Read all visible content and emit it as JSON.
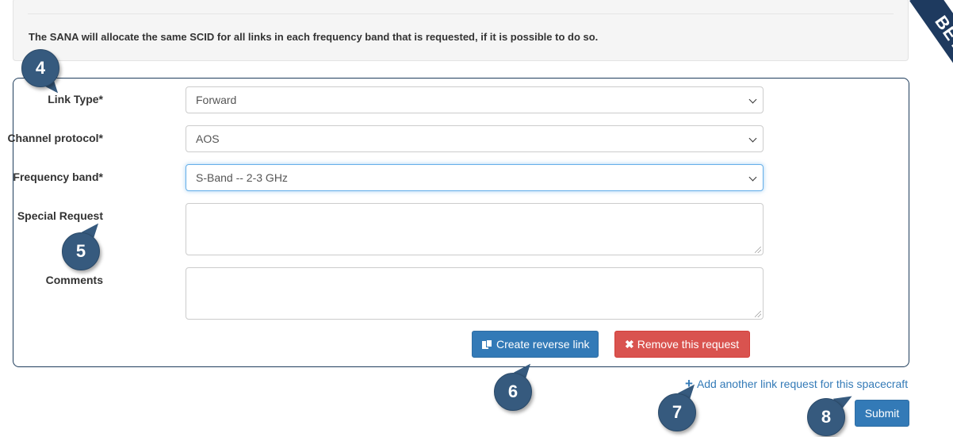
{
  "info": {
    "note": "The SANA will allocate the same SCID for all links in each frequency band that is requested, if it is possible to do so."
  },
  "ribbon": {
    "label": "BETA"
  },
  "form": {
    "link_type": {
      "label": "Link Type*",
      "value": "Forward"
    },
    "channel_protocol": {
      "label": "Channel protocol*",
      "value": "AOS"
    },
    "frequency_band": {
      "label": "Frequency band*",
      "value": "S-Band -- 2-3 GHz"
    },
    "special_request": {
      "label": "Special Request",
      "value": ""
    },
    "comments": {
      "label": "Comments",
      "value": ""
    },
    "create_reverse_label": "Create reverse link",
    "remove_request_label": "Remove this request"
  },
  "add_link_label": "Add another link request for this spacecraft",
  "submit_label": "Submit",
  "callouts": [
    "4",
    "5",
    "6",
    "7",
    "8"
  ],
  "colors": {
    "primary": "#337ab7",
    "danger": "#d9534f",
    "panel_border": "#1f3d5c",
    "callout": "#365a7e"
  }
}
